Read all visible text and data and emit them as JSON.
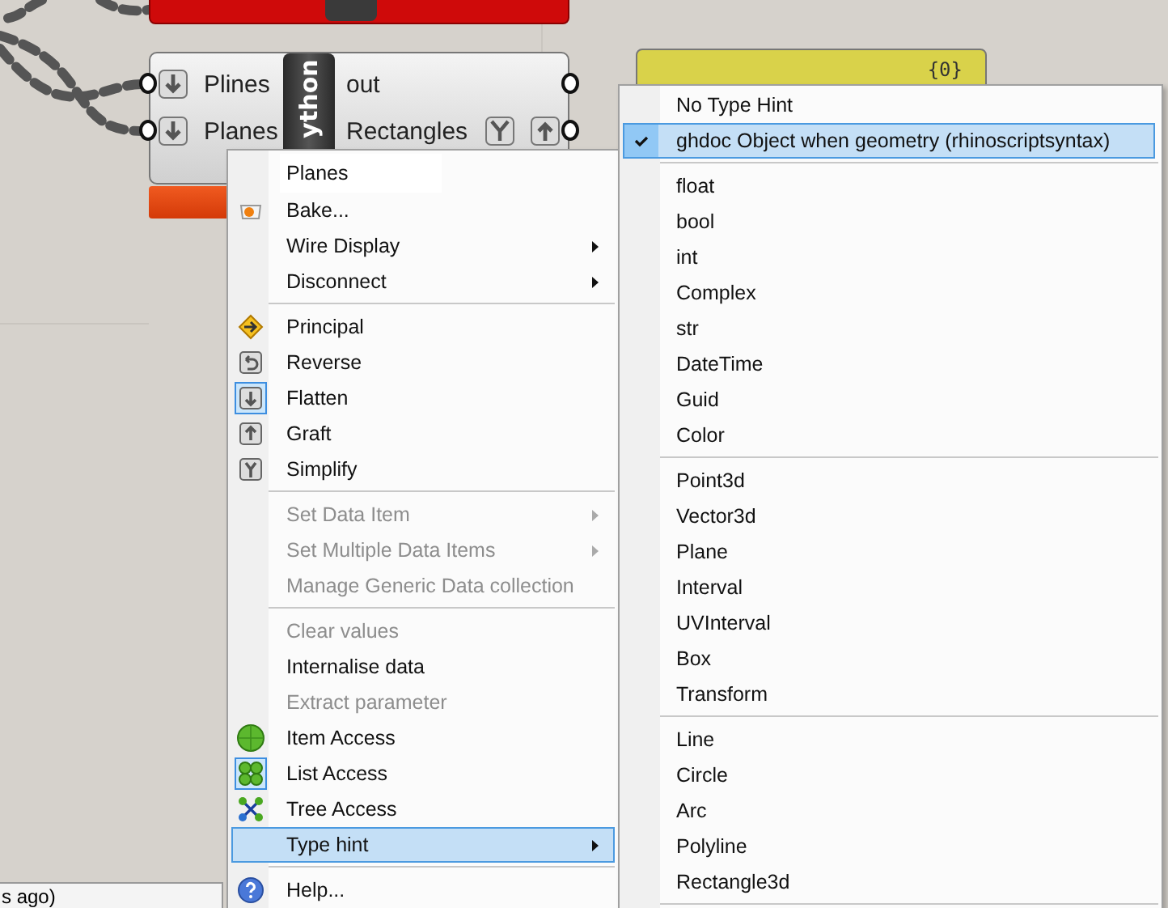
{
  "python_component": {
    "name": "ython",
    "inputs": [
      {
        "label": "Plines"
      },
      {
        "label": "Planes"
      }
    ],
    "outputs": [
      {
        "label": "out"
      },
      {
        "label": "Rectangles"
      }
    ]
  },
  "panel": {
    "value": "{0}"
  },
  "status_text": "s ago)",
  "context_menu": {
    "header": "Planes",
    "sections": [
      {
        "items": [
          {
            "label": "Bake...",
            "disabled": false,
            "submenu": false,
            "checked": false,
            "selected": false
          },
          {
            "label": "Wire Display",
            "disabled": false,
            "submenu": true,
            "checked": false,
            "selected": false
          },
          {
            "label": "Disconnect",
            "disabled": false,
            "submenu": true,
            "checked": false,
            "selected": false
          }
        ]
      },
      {
        "items": [
          {
            "label": "Principal",
            "disabled": false,
            "submenu": false,
            "checked": false,
            "selected": false
          },
          {
            "label": "Reverse",
            "disabled": false,
            "submenu": false,
            "checked": false,
            "selected": false
          },
          {
            "label": "Flatten",
            "disabled": false,
            "submenu": false,
            "checked": true,
            "selected": false
          },
          {
            "label": "Graft",
            "disabled": false,
            "submenu": false,
            "checked": false,
            "selected": false
          },
          {
            "label": "Simplify",
            "disabled": false,
            "submenu": false,
            "checked": false,
            "selected": false
          }
        ]
      },
      {
        "items": [
          {
            "label": "Set Data Item",
            "disabled": true,
            "submenu": true,
            "checked": false,
            "selected": false
          },
          {
            "label": "Set Multiple Data Items",
            "disabled": true,
            "submenu": true,
            "checked": false,
            "selected": false
          },
          {
            "label": "Manage Generic Data collection",
            "disabled": true,
            "submenu": false,
            "checked": false,
            "selected": false
          }
        ]
      },
      {
        "items": [
          {
            "label": "Clear values",
            "disabled": true,
            "submenu": false,
            "checked": false,
            "selected": false
          },
          {
            "label": "Internalise data",
            "disabled": false,
            "submenu": false,
            "checked": false,
            "selected": false
          },
          {
            "label": "Extract parameter",
            "disabled": true,
            "submenu": false,
            "checked": false,
            "selected": false
          },
          {
            "label": "Item Access",
            "disabled": false,
            "submenu": false,
            "checked": false,
            "selected": false
          },
          {
            "label": "List Access",
            "disabled": false,
            "submenu": false,
            "checked": true,
            "selected": false
          },
          {
            "label": "Tree Access",
            "disabled": false,
            "submenu": false,
            "checked": false,
            "selected": false
          },
          {
            "label": "Type hint",
            "disabled": false,
            "submenu": true,
            "checked": false,
            "selected": true
          }
        ]
      },
      {
        "items": [
          {
            "label": "Help...",
            "disabled": false,
            "submenu": false,
            "checked": false,
            "selected": false
          }
        ]
      }
    ]
  },
  "type_hint_menu": {
    "sections": [
      {
        "items": [
          {
            "label": "No Type Hint",
            "checked": false,
            "selected": false
          },
          {
            "label": "ghdoc Object when geometry (rhinoscriptsyntax)",
            "checked": true,
            "selected": true
          }
        ]
      },
      {
        "items": [
          {
            "label": "float",
            "checked": false,
            "selected": false
          },
          {
            "label": "bool",
            "checked": false,
            "selected": false
          },
          {
            "label": "int",
            "checked": false,
            "selected": false
          },
          {
            "label": "Complex",
            "checked": false,
            "selected": false
          },
          {
            "label": "str",
            "checked": false,
            "selected": false
          },
          {
            "label": "DateTime",
            "checked": false,
            "selected": false
          },
          {
            "label": "Guid",
            "checked": false,
            "selected": false
          },
          {
            "label": "Color",
            "checked": false,
            "selected": false
          }
        ]
      },
      {
        "items": [
          {
            "label": "Point3d",
            "checked": false,
            "selected": false
          },
          {
            "label": "Vector3d",
            "checked": false,
            "selected": false
          },
          {
            "label": "Plane",
            "checked": false,
            "selected": false
          },
          {
            "label": "Interval",
            "checked": false,
            "selected": false
          },
          {
            "label": "UVInterval",
            "checked": false,
            "selected": false
          },
          {
            "label": "Box",
            "checked": false,
            "selected": false
          },
          {
            "label": "Transform",
            "checked": false,
            "selected": false
          }
        ]
      },
      {
        "items": [
          {
            "label": "Line",
            "checked": false,
            "selected": false
          },
          {
            "label": "Circle",
            "checked": false,
            "selected": false
          },
          {
            "label": "Arc",
            "checked": false,
            "selected": false
          },
          {
            "label": "Polyline",
            "checked": false,
            "selected": false
          },
          {
            "label": "Rectangle3d",
            "checked": false,
            "selected": false
          }
        ]
      }
    ]
  }
}
